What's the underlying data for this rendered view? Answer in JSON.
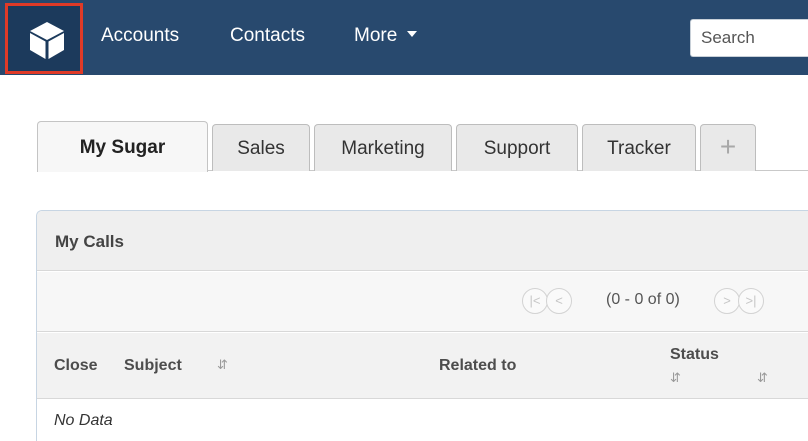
{
  "nav": {
    "items": [
      {
        "label": "Accounts"
      },
      {
        "label": "Contacts"
      },
      {
        "label": "More"
      }
    ],
    "search_placeholder": "Search",
    "logo_icon": "sugar-cube-icon",
    "highlight_color": "#e03a27",
    "background_color": "#28496e"
  },
  "tabs": [
    {
      "label": "My Sugar",
      "active": true
    },
    {
      "label": "Sales"
    },
    {
      "label": "Marketing"
    },
    {
      "label": "Support"
    },
    {
      "label": "Tracker"
    },
    {
      "label": "+"
    }
  ],
  "dashlet": {
    "title": "My Calls",
    "pager": {
      "count_text": "(0 - 0 of 0)",
      "first_icon": "first-page-icon",
      "prev_icon": "prev-page-icon",
      "next_icon": "next-page-icon",
      "last_icon": "last-page-icon"
    },
    "columns": {
      "close": "Close",
      "subject": "Subject",
      "related_to": "Related to",
      "status": "Status"
    },
    "empty_text": "No Data"
  }
}
